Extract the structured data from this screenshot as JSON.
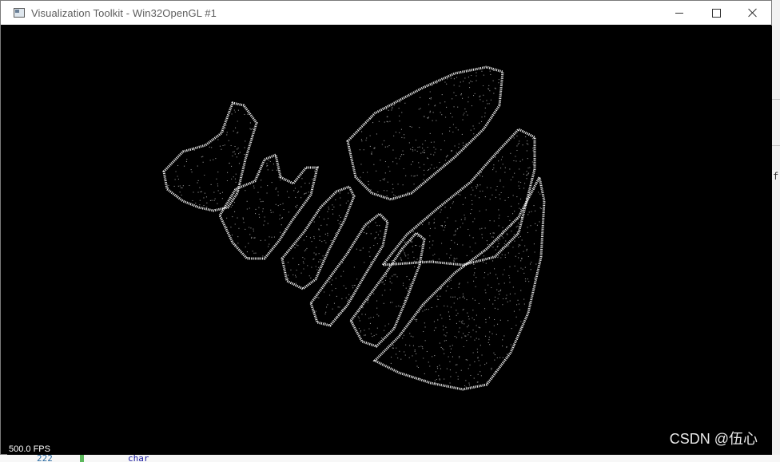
{
  "window": {
    "title": "Visualization Toolkit - Win32OpenGL #1",
    "icon": "app-window-icon",
    "controls": {
      "minimize": "minimize-icon",
      "maximize": "maximize-icon",
      "close": "close-icon"
    }
  },
  "viewport": {
    "background": "#000000",
    "point_color": "#ffffff",
    "fps_text": "500.0 FPS"
  },
  "watermark": {
    "text": "CSDN @伍心"
  },
  "background_app": {
    "right_edge_text": "f",
    "line_number": "222",
    "code_fragment": "char"
  }
}
